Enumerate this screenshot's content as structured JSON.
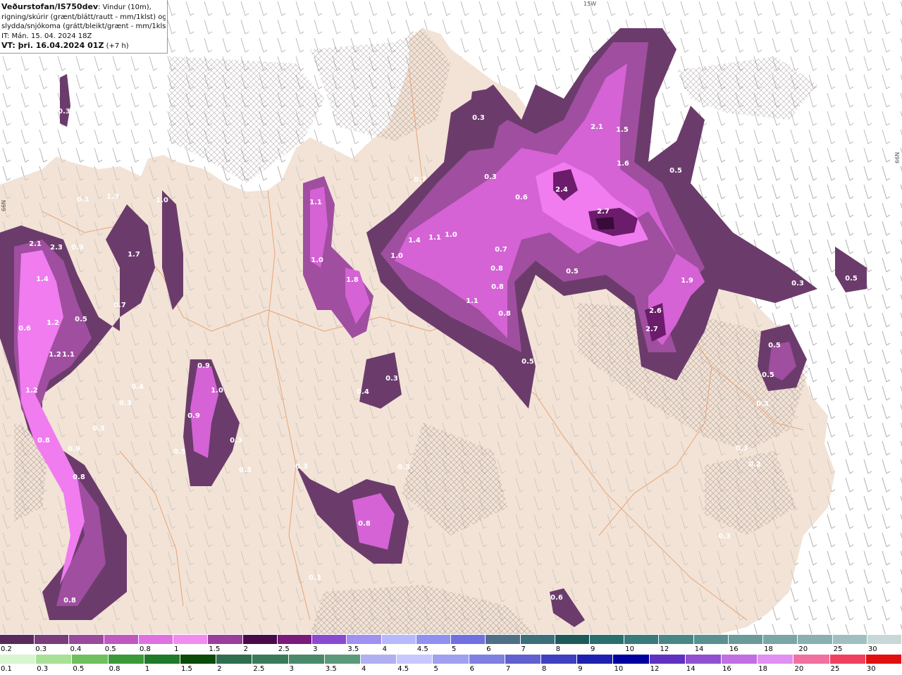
{
  "info_box": {
    "line1_bold": "Veðurstofan/IS750dev",
    "line1_rest": ": Vindur (10m),",
    "line2": "rigning/skúrir (grænt/blátt/rautt - mm/1klst) og",
    "line3": "slydda/snjókoma (grátt/bleikt/grænt - mm/1klst)",
    "line4": "IT: Mán. 15. 04. 2024 18Z",
    "line5_bold": "VT: þri. 16.04.2024 01Z",
    "line5_rest": " (+7 h)"
  },
  "map": {
    "lat_labels": [
      "66N",
      "66N",
      "15W"
    ],
    "value_labels": [
      "0.1",
      "2.1",
      "2.3",
      "0.9",
      "1.4",
      "1.3",
      "1.0",
      "1.7",
      "0.7",
      "0.6",
      "1.2",
      "0.5",
      "1.2",
      "1.1",
      "0.4",
      "0.3",
      "1.2",
      "0.9",
      "0.8",
      "0.8",
      "0.9",
      "0.3",
      "0.9",
      "0.5",
      "1.0",
      "0.3",
      "0.3",
      "0.3",
      "1.1",
      "1.0",
      "1.8",
      "0.4",
      "0.3",
      "0.3",
      "0.8",
      "0.3",
      "0.7",
      "1.4",
      "1.1",
      "1.0",
      "1.0",
      "1.1",
      "0.7",
      "0.8",
      "0.8",
      "0.8",
      "0.5",
      "0.3",
      "0.6",
      "0.3",
      "2.1",
      "1.5",
      "1.6",
      "2.4",
      "2.7",
      "0.5",
      "0.5",
      "0.3",
      "1.9",
      "2.6",
      "2.7",
      "0.3",
      "0.5",
      "0.5",
      "0.5",
      "0.3",
      "0.2",
      "0.3",
      "0.6",
      "0.3",
      "0.8"
    ]
  },
  "colors": {
    "land": "#f2e3d6",
    "sea": "#ffffff",
    "road": "#e8a070",
    "precip_levels": [
      "#6b3c6b",
      "#a04ea0",
      "#d563d5",
      "#f07cf0",
      "#6b1c6b",
      "#3a0a3a"
    ]
  },
  "legend_snow": {
    "ticks": [
      "0.2",
      "0.3",
      "0.4",
      "0.5",
      "0.8",
      "1",
      "1.5",
      "2",
      "2.5",
      "3",
      "3.5",
      "4",
      "4.5",
      "5",
      "6",
      "7",
      "8",
      "9",
      "10",
      "12",
      "14",
      "16",
      "18",
      "20",
      "25",
      "30"
    ],
    "colors": [
      "#5a2a5a",
      "#7a3c7a",
      "#9a4a9a",
      "#c058c0",
      "#e070e0",
      "#f08cf0",
      "#9b3d9b",
      "#4a0a4a",
      "#7a1a7a",
      "#8a4ad0",
      "#a090f0",
      "#b8b8ff",
      "#9090f0",
      "#7070e0",
      "#4f6f86",
      "#3d6f7a",
      "#1f5a5a",
      "#2a6e6e",
      "#3a7a7a",
      "#4a8686",
      "#5a9090",
      "#6a9a9a",
      "#7aa6a6",
      "#8ab0b0",
      "#a0c0c0",
      "#c8d8d8"
    ]
  },
  "legend_rain": {
    "ticks": [
      "0.1",
      "0.3",
      "0.5",
      "0.8",
      "1",
      "1.5",
      "2",
      "2.5",
      "3",
      "3.5",
      "4",
      "4.5",
      "5",
      "6",
      "7",
      "8",
      "9",
      "10",
      "12",
      "14",
      "16",
      "18",
      "20",
      "25",
      "30"
    ],
    "colors": [
      "#d8f5d0",
      "#a8e098",
      "#70c060",
      "#3a9a3a",
      "#1f7a2a",
      "#0a4a0a",
      "#2e6e4e",
      "#3a7a5a",
      "#4a8a6a",
      "#5a9a7a",
      "#b0b0f0",
      "#c8c8ff",
      "#a0a0f0",
      "#8080e0",
      "#6060d0",
      "#4040c0",
      "#2020b0",
      "#0000a0",
      "#6030c0",
      "#9050d0",
      "#c070e0",
      "#e090f0",
      "#f070a0",
      "#f04060",
      "#e01010"
    ]
  }
}
